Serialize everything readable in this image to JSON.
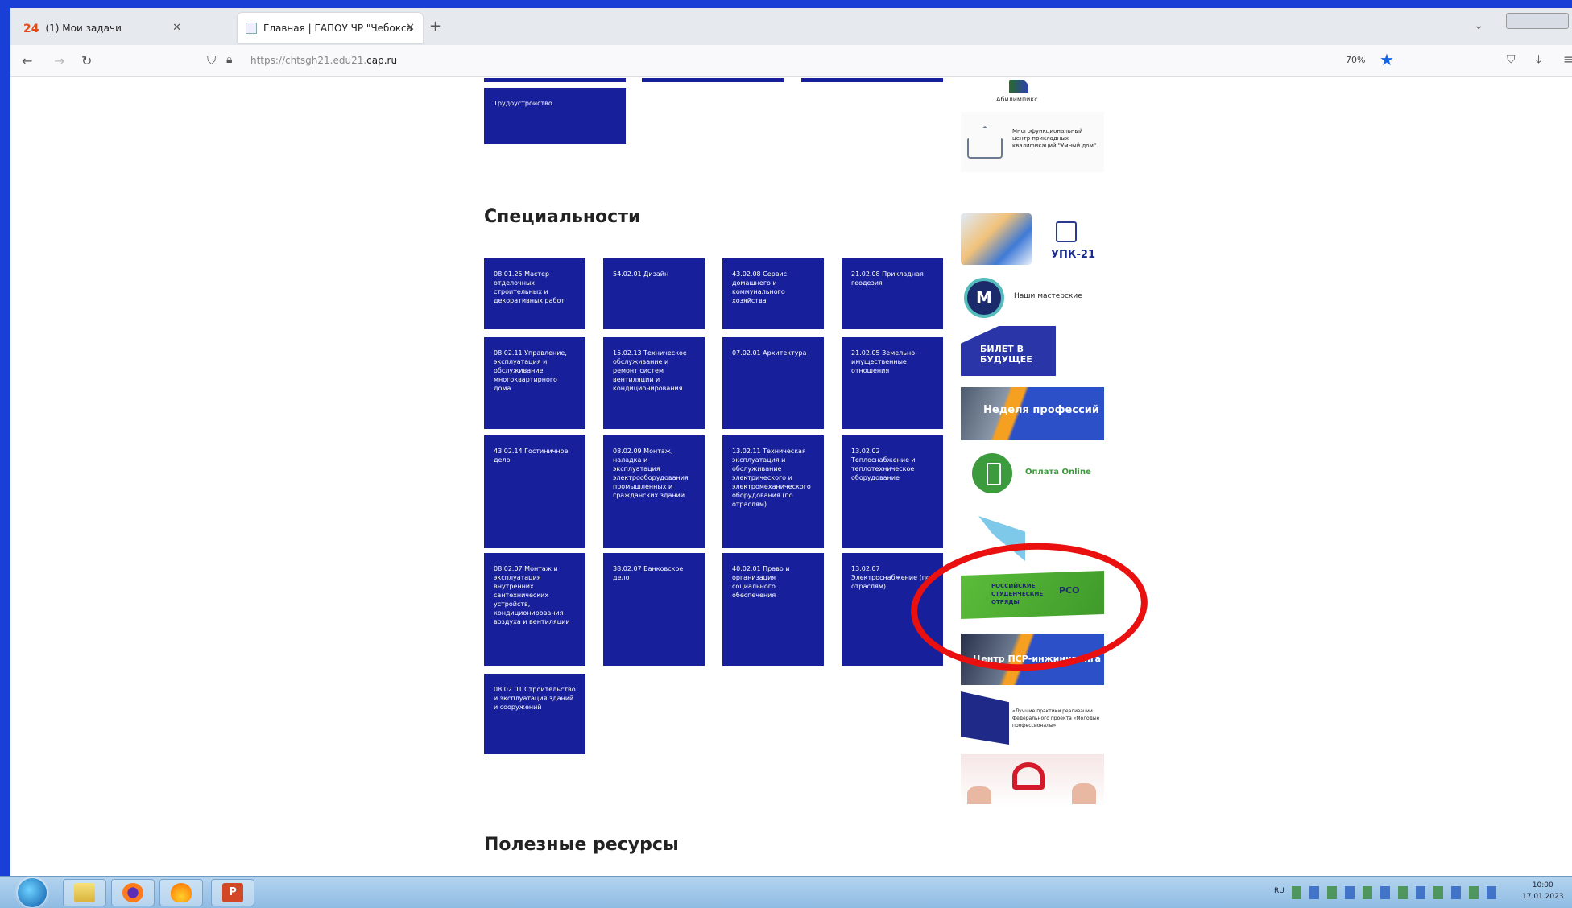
{
  "browser": {
    "tabs": [
      {
        "label": "(1) Мои задачи",
        "badge": "24"
      },
      {
        "label": "Главная | ГАПОУ ЧР \"Чебокса"
      }
    ],
    "url_prefix": "https://chtsgh21.edu21.",
    "url_domain": "cap.ru",
    "zoom": "70%"
  },
  "page": {
    "tile_top": "Трудоустройство",
    "specialties_heading": "Специальности",
    "resources_heading": "Полезные ресурсы",
    "specialties": [
      "08.01.25 Мастер отделочных строительных и декоративных работ",
      "54.02.01 Дизайн",
      "43.02.08 Сервис домашнего и коммунального хозяйства",
      "21.02.08 Прикладная геодезия",
      "08.02.11 Управление, эксплуатация и обслуживание многоквартирного дома",
      "15.02.13 Техническое обслуживание и ремонт систем вентиляции и кондиционирования",
      "07.02.01 Архитектура",
      "21.02.05 Земельно-имущественные отношения",
      "43.02.14 Гостиничное дело",
      "08.02.09 Монтаж, наладка и эксплуатация электрооборудования промышленных и гражданских зданий",
      "13.02.11 Техническая эксплуатация и обслуживание электрического и электромеханического оборудования (по отраслям)",
      "13.02.02 Теплоснабжение и теплотехническое оборудование",
      "08.02.07 Монтаж и эксплуатация внутренних сантехнических устройств, кондиционирования воздуха и вентиляции",
      "38.02.07 Банковское дело",
      "40.02.01 Право и организация социального обеспечения",
      "13.02.07 Электроснабжение (по отраслям)",
      "08.02.01 Строительство и эксплуатация зданий и сооружений"
    ]
  },
  "sidebar": {
    "abb_label": "Абилимпикс",
    "mfc_text": "Многофункциональный центр прикладных квалификаций \"Умный дом\"",
    "upk_label": "УПК-21",
    "mast_icon": "M",
    "mast_label": "Наши мастерские",
    "bilet_label": "БИЛЕТ В БУДУЩЕЕ",
    "nedelya_label": "Неделя профессий",
    "pay_label": "Оплата Online",
    "rso_label": "РОССИЙСКИЕ СТУДЕНЧЕСКИЕ ОТРЯДЫ",
    "rso_logo": "РСО",
    "psr_label": "Центр ПСР-инжиниринга",
    "prof_text": "«Лучшие практики реализации Федерального проекта «Молодые профессионалы»"
  },
  "taskbar": {
    "ppt_glyph": "P",
    "lang": "RU",
    "time": "10:00",
    "date": "17.01.2023"
  },
  "colors": {
    "tile": "#17209a",
    "annotation": "#ea1010",
    "frame": "#1a3fd6"
  }
}
